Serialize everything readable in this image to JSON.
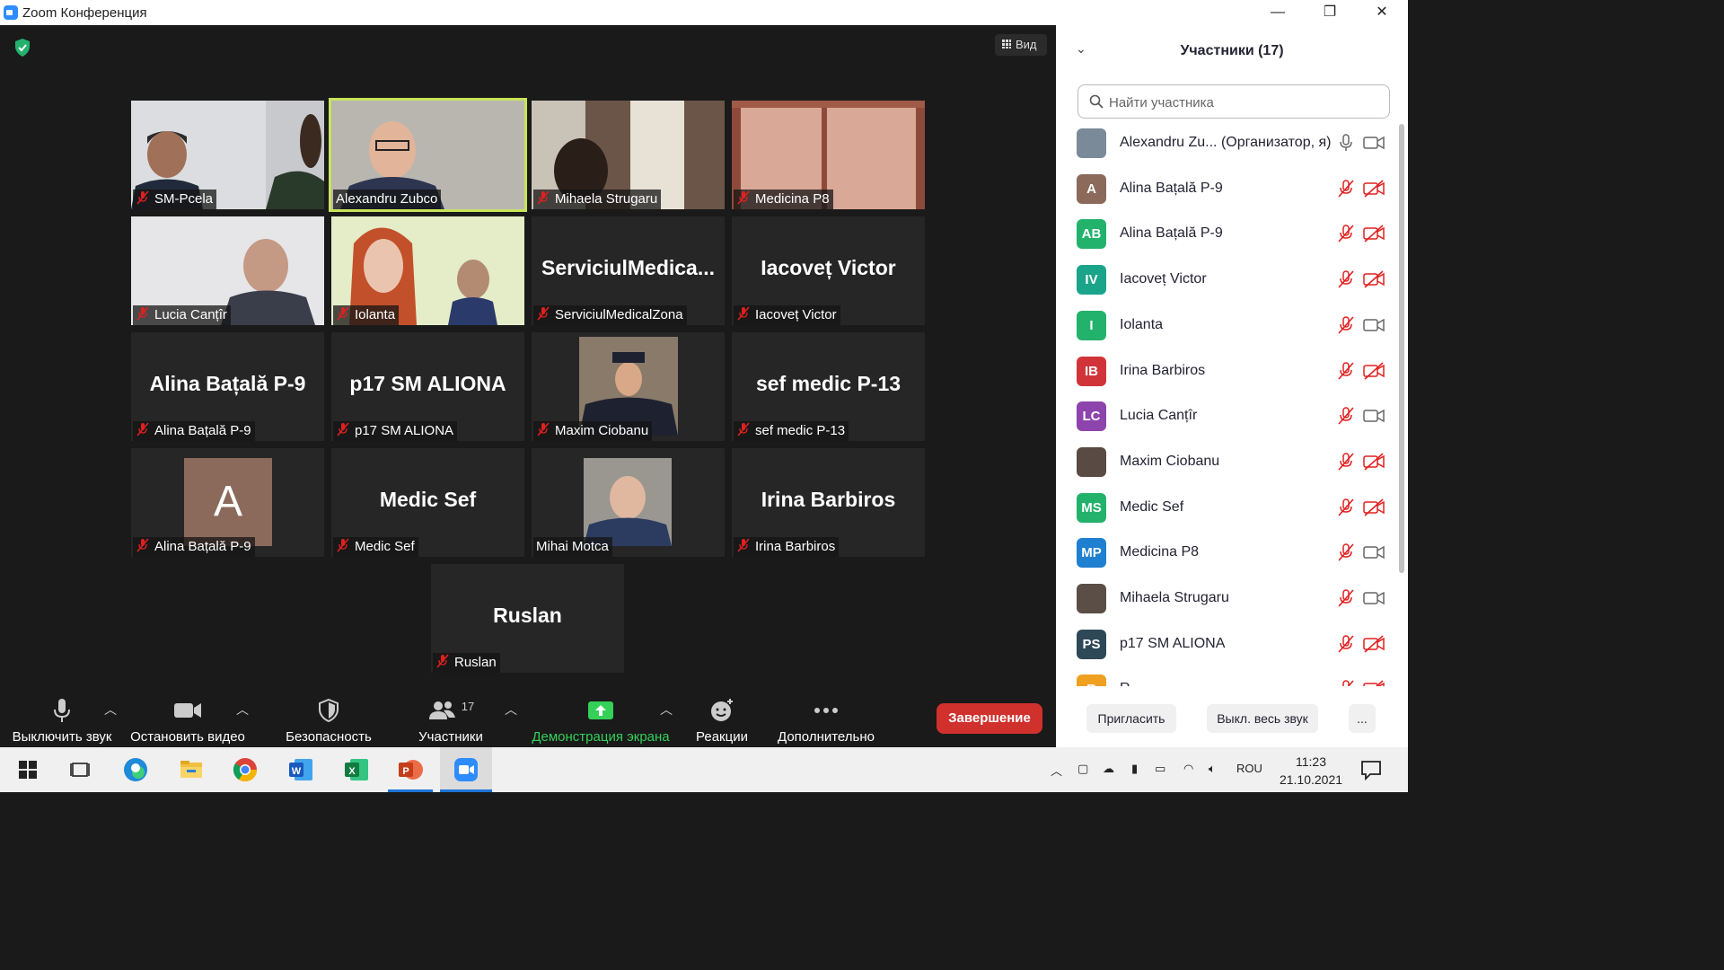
{
  "window": {
    "title": "Zoom Конференция",
    "minimize": "—",
    "maximize": "❐",
    "close": "✕"
  },
  "view_label": "Вид",
  "tiles": [
    {
      "name": "SM-Pcela",
      "big": ""
    },
    {
      "name": "Alexandru Zubco",
      "big": ""
    },
    {
      "name": "Mihaela Strugaru",
      "big": ""
    },
    {
      "name": "Medicina P8",
      "big": ""
    },
    {
      "name": "Lucia Canțîr",
      "big": ""
    },
    {
      "name": "Iolanta",
      "big": ""
    },
    {
      "name": "ServiciulMedicalZona",
      "big": "ServiciulMedica..."
    },
    {
      "name": "Iacoveț Victor",
      "big": "Iacoveț Victor"
    },
    {
      "name": "Alina Bațală P-9",
      "big": "Alina Bațală P-9"
    },
    {
      "name": "p17 SM ALIONA",
      "big": "p17 SM ALIONA"
    },
    {
      "name": "Maxim Ciobanu",
      "big": ""
    },
    {
      "name": "sef medic P-13",
      "big": "sef medic P-13"
    },
    {
      "name": "Alina Bațală P-9",
      "big": "",
      "avatar": "A"
    },
    {
      "name": "Medic Sef",
      "big": "Medic Sef"
    },
    {
      "name": "Mihai Motca",
      "big": ""
    },
    {
      "name": "Irina Barbiros",
      "big": "Irina Barbiros"
    },
    {
      "name": "Ruslan",
      "big": "Ruslan"
    }
  ],
  "toolbar": {
    "mute": "Выключить звук",
    "stop_video": "Остановить видео",
    "security": "Безопасность",
    "participants": "Участники",
    "participants_count": "17",
    "share": "Демонстрация экрана",
    "reactions": "Реакции",
    "more": "Дополнительно",
    "end": "Завершение"
  },
  "panel": {
    "title": "Участники (17)",
    "search_placeholder": "Найти участника",
    "participants": [
      {
        "name": "Alexandru Zu...   (Организатор, я)",
        "initials": "",
        "color": "#7a8a99",
        "muted": false,
        "video_off": false
      },
      {
        "name": "Alina Bațală P-9",
        "initials": "A",
        "color": "#8b6a5c",
        "muted": true,
        "video_off": true
      },
      {
        "name": "Alina Bațală P-9",
        "initials": "AB",
        "color": "#23b26b",
        "muted": true,
        "video_off": true
      },
      {
        "name": "Iacoveț Victor",
        "initials": "IV",
        "color": "#1aa58a",
        "muted": true,
        "video_off": true
      },
      {
        "name": "Iolanta",
        "initials": "I",
        "color": "#23b26b",
        "muted": true,
        "video_off": false
      },
      {
        "name": "Irina Barbiros",
        "initials": "IB",
        "color": "#d13438",
        "muted": true,
        "video_off": true
      },
      {
        "name": "Lucia Canțîr",
        "initials": "LC",
        "color": "#8e44ad",
        "muted": true,
        "video_off": false
      },
      {
        "name": "Maxim Ciobanu",
        "initials": "",
        "color": "#5a4a44",
        "muted": true,
        "video_off": true
      },
      {
        "name": "Medic Sef",
        "initials": "MS",
        "color": "#23b26b",
        "muted": true,
        "video_off": true
      },
      {
        "name": "Medicina P8",
        "initials": "MP",
        "color": "#1f7fd0",
        "muted": true,
        "video_off": false
      },
      {
        "name": "Mihaela Strugaru",
        "initials": "",
        "color": "#5b4e47",
        "muted": true,
        "video_off": false
      },
      {
        "name": "p17 SM ALIONA",
        "initials": "PS",
        "color": "#2f4858",
        "muted": true,
        "video_off": true
      },
      {
        "name": "R...",
        "initials": "R",
        "color": "#f0a020",
        "muted": true,
        "video_off": true
      }
    ],
    "invite": "Пригласить",
    "mute_all": "Выкл. весь звук",
    "more": "..."
  },
  "taskbar": {
    "lang": "ROU",
    "time": "11:23",
    "date": "21.10.2021"
  }
}
